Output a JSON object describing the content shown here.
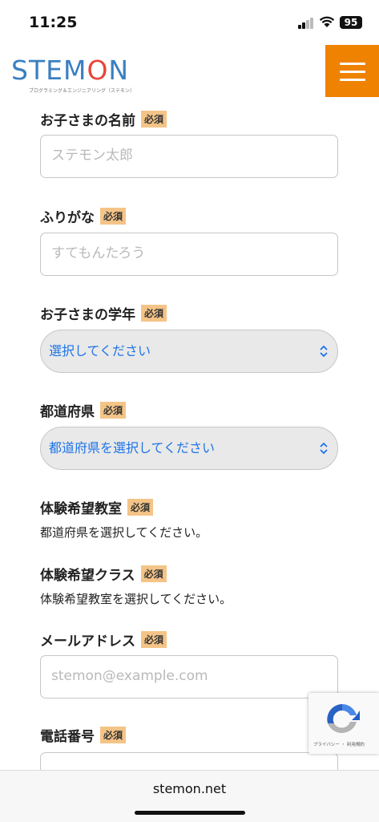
{
  "status": {
    "time": "11:25",
    "battery": "95"
  },
  "header": {
    "logo_text": [
      "STEM",
      "O",
      "N"
    ],
    "logo_sub": "プログラミング＆エンジニアリング（ステモン）",
    "menu_label": "menu-icon"
  },
  "form": {
    "required": "必須",
    "child_name": {
      "label": "お子さまの名前",
      "placeholder": "ステモン太郎"
    },
    "furigana": {
      "label": "ふりがな",
      "placeholder": "すてもんたろう"
    },
    "grade": {
      "label": "お子さまの学年",
      "value": "選択してください"
    },
    "prefecture": {
      "label": "都道府県",
      "value": "都道府県を選択してください"
    },
    "classroom": {
      "label": "体験希望教室",
      "text": "都道府県を選択してください。"
    },
    "class_type": {
      "label": "体験希望クラス",
      "text": "体験希望教室を選択してください。"
    },
    "email": {
      "label": "メールアドレス",
      "placeholder": "stemon@example.com"
    },
    "phone": {
      "label": "電話番号"
    }
  },
  "recaptcha": {
    "text": "プライバシー ・ 利用規約"
  },
  "browser": {
    "url": "stemon.net"
  }
}
